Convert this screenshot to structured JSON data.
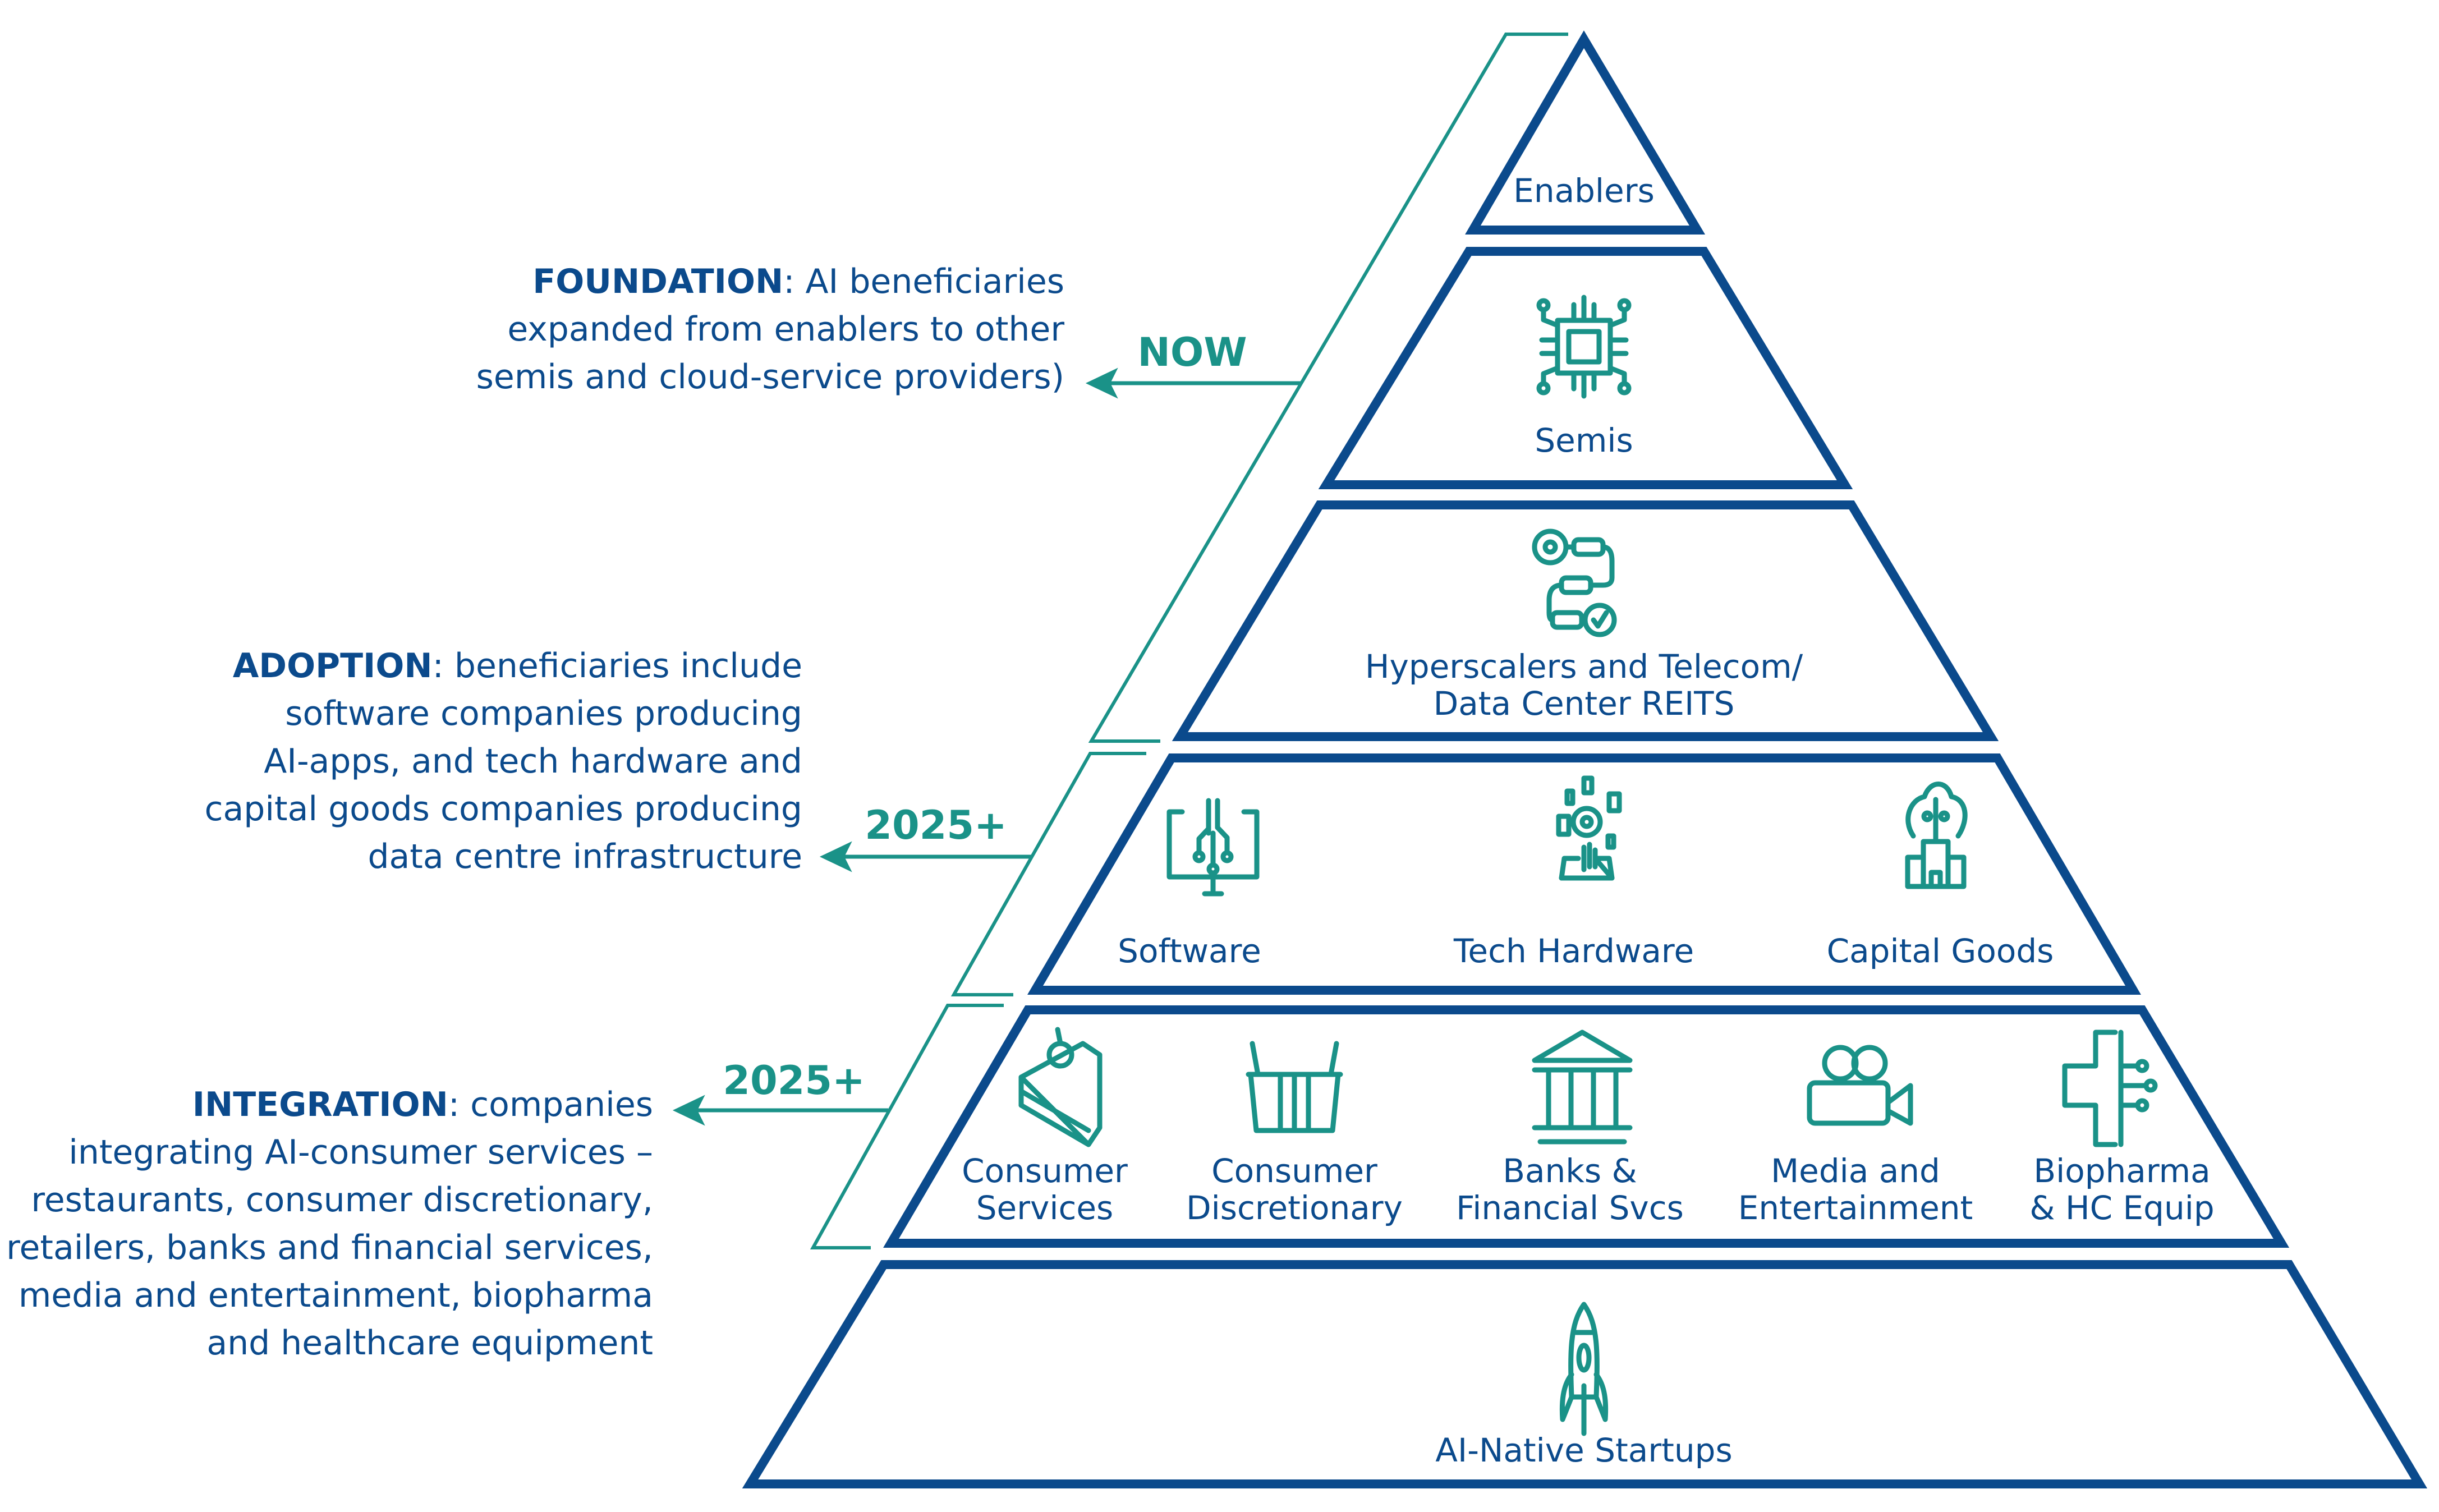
{
  "colors": {
    "tier_outline": "#0b4a8c",
    "accent_teal": "#1a9288",
    "text": "#0b4a8c",
    "background": "#ffffff"
  },
  "stages": [
    {
      "title": "FOUNDATION",
      "description": ": AI beneficiaries expanded from enablers to other semis and cloud-service providers)",
      "lines": [
        "expanded from enablers to other",
        "semis and cloud-service providers)"
      ],
      "first_line_rest": ": AI beneficiaries",
      "period": "NOW"
    },
    {
      "title": "ADOPTION",
      "first_line_rest": ": beneficiaries include",
      "lines": [
        "software companies producing",
        "AI-apps, and tech hardware and",
        "capital goods companies producing",
        "data centre infrastructure"
      ],
      "period": "2025+"
    },
    {
      "title": "INTEGRATION",
      "first_line_rest": ": companies",
      "lines": [
        "integrating AI-consumer services –",
        "restaurants, consumer discretionary,",
        "retailers, banks and financial services,",
        "media and entertainment, biopharma",
        "and healthcare equipment"
      ],
      "period": "2025+"
    }
  ],
  "pyramid": {
    "tiers": [
      {
        "items": [
          {
            "label": [
              "Enablers"
            ],
            "icon": null
          }
        ]
      },
      {
        "items": [
          {
            "label": [
              "Semis"
            ],
            "icon": "chip-icon"
          }
        ]
      },
      {
        "items": [
          {
            "label": [
              "Hyperscalers and Telecom/",
              "Data Center REITS"
            ],
            "icon": "workflow-gear-icon"
          }
        ]
      },
      {
        "items": [
          {
            "label": [
              "Software"
            ],
            "icon": "software-monitor-icon"
          },
          {
            "label": [
              "Tech Hardware"
            ],
            "icon": "tech-hardware-icon"
          },
          {
            "label": [
              "Capital Goods"
            ],
            "icon": "capital-goods-icon"
          }
        ]
      },
      {
        "items": [
          {
            "label": [
              "Consumer",
              "Services"
            ],
            "icon": "cake-icon"
          },
          {
            "label": [
              "Consumer",
              "Discretionary"
            ],
            "icon": "basket-icon"
          },
          {
            "label": [
              "Banks &",
              "Financial Svcs"
            ],
            "icon": "bank-icon"
          },
          {
            "label": [
              "Media and",
              "Entertainment"
            ],
            "icon": "video-camera-icon"
          },
          {
            "label": [
              "Biopharma",
              "& HC Equip"
            ],
            "icon": "medical-cross-icon"
          }
        ]
      },
      {
        "items": [
          {
            "label": [
              "AI-Native Startups"
            ],
            "icon": "rocket-icon"
          }
        ]
      }
    ]
  }
}
